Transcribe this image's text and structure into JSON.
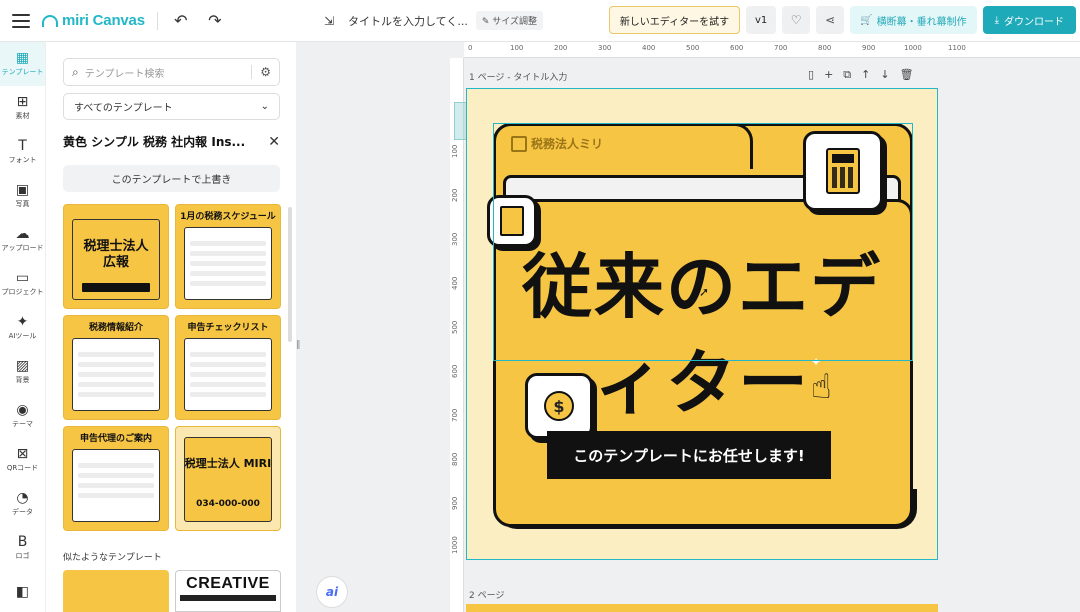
{
  "topbar": {
    "logo": "miri Canvas",
    "title": "タイトルを入力してく...",
    "size_chip": "サイズ調整",
    "new_editor": "新しいエディターを試す",
    "version": "v1",
    "print_btn": "横断幕・垂れ幕制作",
    "download_btn": "ダウンロード"
  },
  "leftnav": [
    {
      "icon": "▦",
      "label": "テンプレート"
    },
    {
      "icon": "⊞",
      "label": "素材"
    },
    {
      "icon": "T",
      "label": "フォント"
    },
    {
      "icon": "▣",
      "label": "写真"
    },
    {
      "icon": "☁",
      "label": "アップロード"
    },
    {
      "icon": "▭",
      "label": "プロジェクト"
    },
    {
      "icon": "✦",
      "label": "AIツール"
    },
    {
      "icon": "▨",
      "label": "背景"
    },
    {
      "icon": "◉",
      "label": "テーマ"
    },
    {
      "icon": "⊠",
      "label": "QRコード"
    },
    {
      "icon": "◔",
      "label": "データ"
    },
    {
      "icon": "B",
      "label": "ロゴ"
    },
    {
      "icon": "◧",
      "label": ""
    }
  ],
  "panel": {
    "search_placeholder": "テンプレート検索",
    "select_value": "すべてのテンプレート",
    "template_title": "黄色 シンプル 税務 社内報 Ins...",
    "overwrite": "このテンプレートで上書き",
    "thumbs": [
      {
        "title": "税理士法人\n広報"
      },
      {
        "title": "1月の税務スケジュール"
      },
      {
        "title": "税務情報紹介"
      },
      {
        "title": "申告チェックリスト"
      },
      {
        "title": "申告代理のご案内"
      },
      {
        "title": "税理士法人 MIRI"
      }
    ],
    "thumb_extra": {
      "phone": "034-000-000"
    },
    "similar": "似たようなテンプレート",
    "similar_creative": "CREATIVE"
  },
  "canvas": {
    "page1_label": "1 ページ - タイトル入力",
    "page2_label": "2 ページ",
    "ruler_top": [
      "0",
      "100",
      "200",
      "300",
      "400",
      "500",
      "600",
      "700",
      "800",
      "900",
      "1000",
      "1100"
    ],
    "ruler_left": [
      "100",
      "200",
      "300",
      "400",
      "500",
      "600",
      "700",
      "800",
      "900",
      "1000"
    ],
    "brand": "税務法人ミリ",
    "headline": "従来のエデ\nィター",
    "cta": "このテンプレートにお任せします!"
  },
  "colors": {
    "accent": "#1faab9",
    "folder_yellow": "#f6c544",
    "page_bg": "#fbeec2"
  }
}
